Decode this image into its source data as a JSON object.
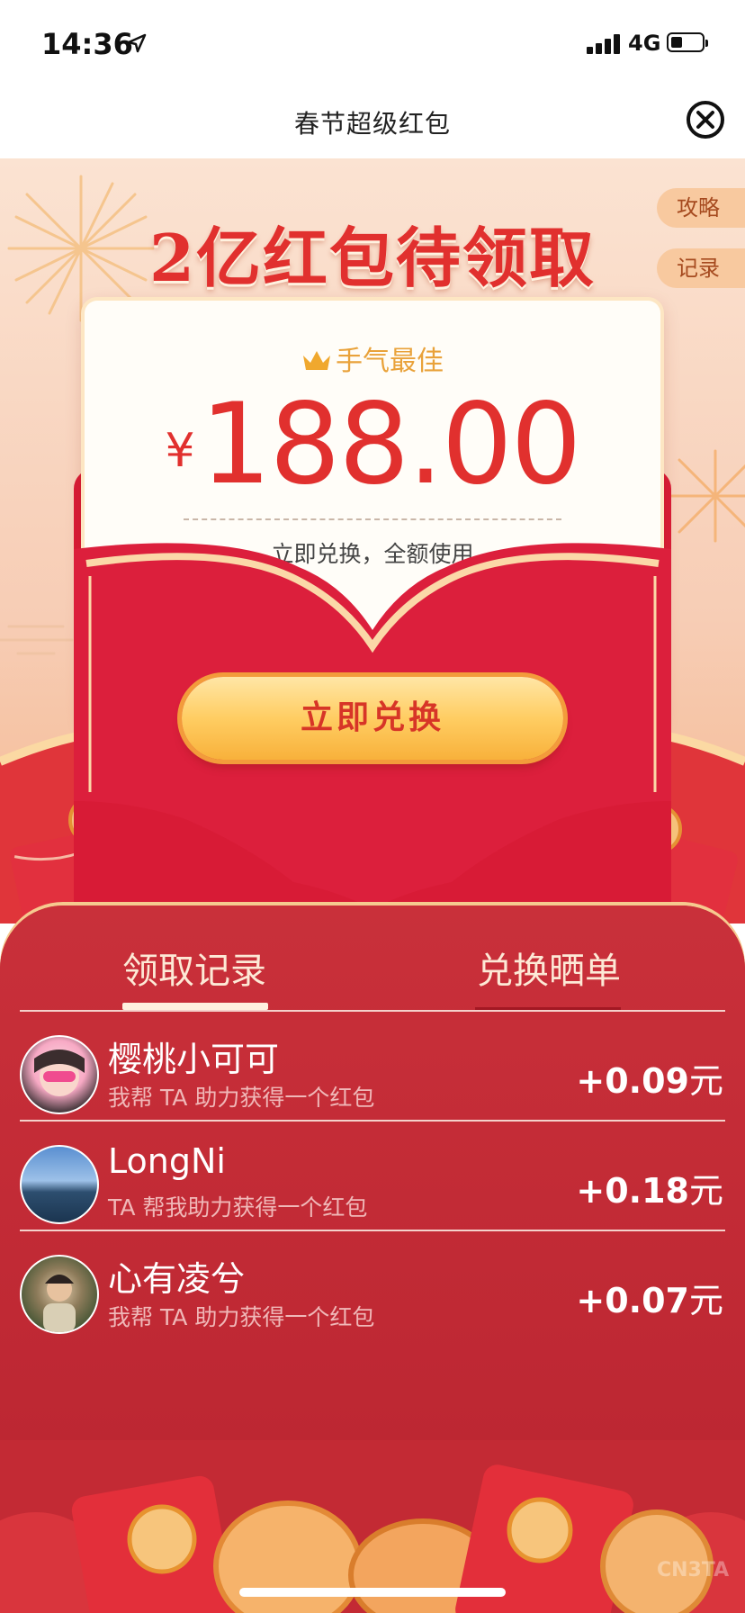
{
  "status_bar": {
    "time": "14:36",
    "network": "4G"
  },
  "nav": {
    "title": "春节超级红包"
  },
  "hero": {
    "headline": "2亿红包待领取",
    "side_tabs": [
      "攻略",
      "记录"
    ]
  },
  "card": {
    "badge": "手气最佳",
    "currency": "¥",
    "amount": "188.00",
    "subtitle": "立即兑换，全额使用",
    "redeem_button": "立即兑换"
  },
  "panel": {
    "tabs": [
      "领取记录",
      "兑换晒单"
    ],
    "active_tab": "领取记录",
    "records": [
      {
        "name": "樱桃小可可",
        "desc": "我帮 TA 助力获得一个红包",
        "amount": "+0.09",
        "unit": "元"
      },
      {
        "name": "LongNi",
        "desc": "TA 帮我助力获得一个红包",
        "amount": "+0.18",
        "unit": "元"
      },
      {
        "name": "心有凌兮",
        "desc": "我帮 TA 助力获得一个红包",
        "amount": "+0.07",
        "unit": "元"
      }
    ]
  },
  "watermark": "CN3TA",
  "colors": {
    "primary_red": "#e1302e",
    "panel_red": "#c32a34",
    "gold": "#f8b13b",
    "peach": "#fbe3d2"
  }
}
